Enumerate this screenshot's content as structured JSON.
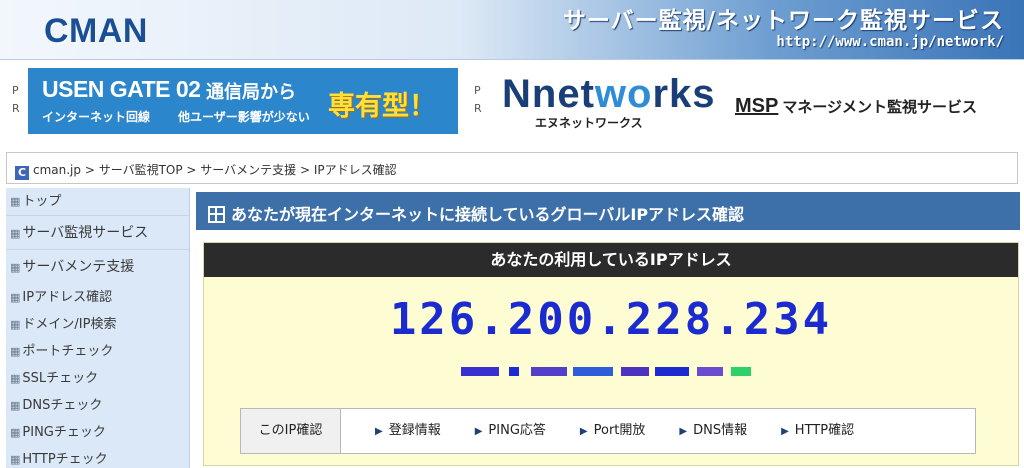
{
  "header": {
    "logo": "CMAN",
    "tagline": "サーバー監視/ネットワーク監視サービス",
    "url": "http://www.cman.jp/network/"
  },
  "ads": {
    "pr_left": [
      "P",
      "R"
    ],
    "pr_right": [
      "P",
      "R"
    ],
    "ad1": {
      "brand": "USEN GATE 02",
      "brand_sub": "インターネット回線",
      "line1": "通信局から",
      "line2": "他ユーザー影響が少ない",
      "highlight": "専有型！"
    },
    "ad2": {
      "brand_pre": "Nnet",
      "brand_o": "wo",
      "brand_post": "rks",
      "kana": "エヌネットワークス",
      "msp_mark": "MSP",
      "msp_text": "マネージメント監視サービス"
    }
  },
  "breadcrumb": {
    "icon": "C",
    "items": [
      "cman.jp",
      "サーバ監視TOP",
      "サーバメンテ支援",
      "IPアドレス確認"
    ],
    "separator": " > "
  },
  "sidebar": {
    "top_items": [
      "トップ",
      "サーバ監視サービス",
      "サーバメンテ支援"
    ],
    "sub_items": [
      "IPアドレス確認",
      "ドメイン/IP検索",
      "ポートチェック",
      "SSLチェック",
      "DNSチェック",
      "PINGチェック",
      "HTTPチェック"
    ]
  },
  "main": {
    "title": "あなたが現在インターネットに接続しているグローバルIPアドレス確認",
    "ip_heading": "あなたの利用しているIPアドレス",
    "ip_value": "126.200.228.234",
    "links_label": "このIP確認",
    "links": [
      "登録情報",
      "PING応答",
      "Port開放",
      "DNS情報",
      "HTTP確認"
    ]
  },
  "colors": {
    "title_bar": "#3d6fa8",
    "ip_text": "#1c2bd0",
    "ip_box_bg": "#fdfcd2",
    "sidebar_bg": "#dbe8f8"
  }
}
